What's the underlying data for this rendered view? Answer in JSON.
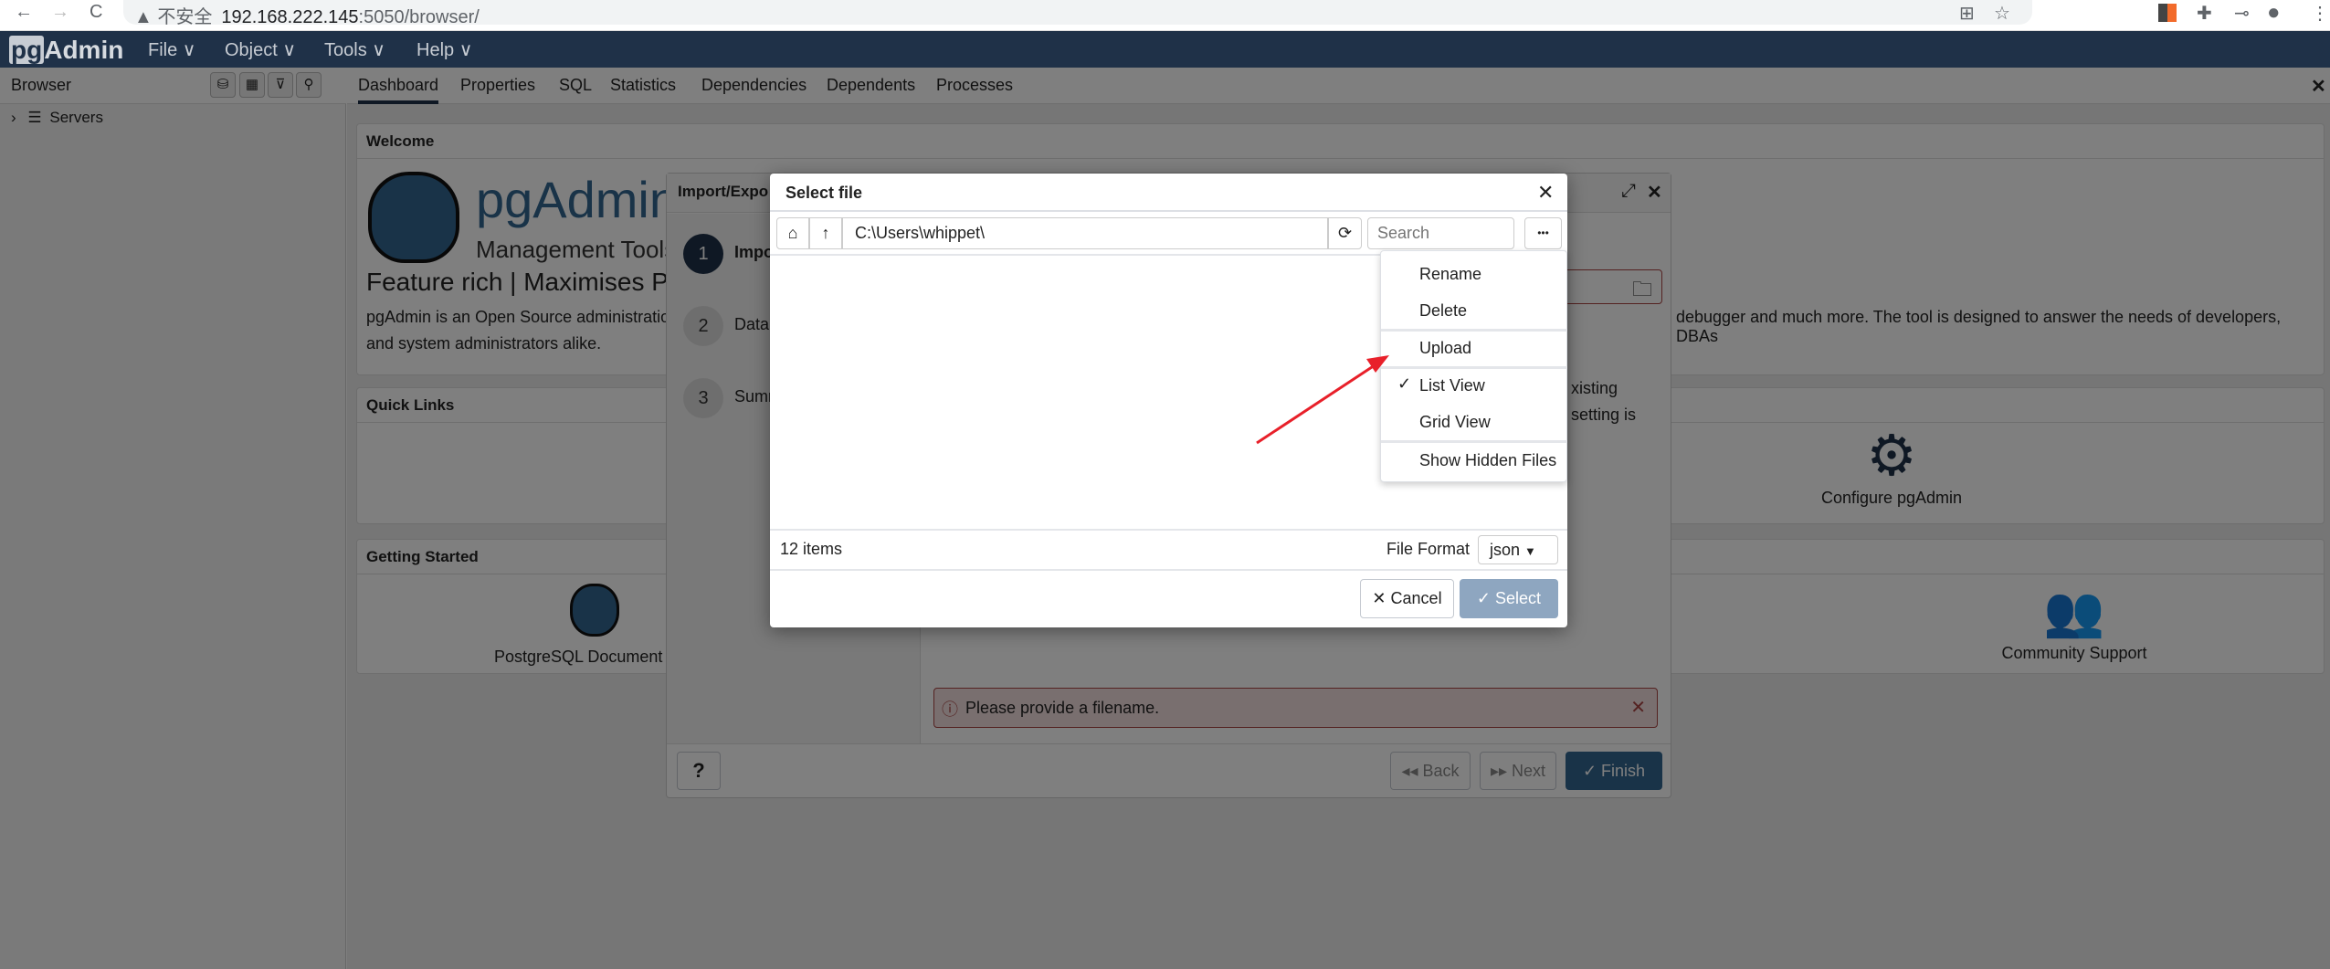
{
  "browser": {
    "back": "←",
    "forward": "→",
    "reload": "C",
    "warning": "▲ 不安全",
    "host": "192.168.222.145",
    "path": ":5050/browser/"
  },
  "app": {
    "logo_pg": "pg",
    "logo_admin": "Admin",
    "menus": [
      "File ∨",
      "Object ∨",
      "Tools ∨",
      "Help ∨"
    ]
  },
  "sidebar": {
    "title": "Browser",
    "tree": [
      {
        "label": "Servers"
      }
    ]
  },
  "tabs": [
    "Dashboard",
    "Properties",
    "SQL",
    "Statistics",
    "Dependencies",
    "Dependents",
    "Processes"
  ],
  "dashboard": {
    "welcome": {
      "title": "Welcome",
      "logo_title": "pgAdmin",
      "logo_sub": "Management Tools",
      "tagline": "Feature rich | Maximises Po",
      "desc_left_1": "pgAdmin is an Open Source administratio",
      "desc_left_2": "and system administrators alike.",
      "desc_right": "debugger and much more. The tool is designed to answer the needs of developers, DBAs"
    },
    "quick_links": {
      "title": "Quick Links",
      "configure": "Configure pgAdmin"
    },
    "getting_started": {
      "title": "Getting Started",
      "docs": "PostgreSQL Document",
      "community": "Community Support"
    }
  },
  "import_dialog": {
    "title": "Import/Expo",
    "steps": [
      {
        "n": "1",
        "label": "Impo"
      },
      {
        "n": "2",
        "label": "Datal"
      },
      {
        "n": "3",
        "label": "Sumr"
      }
    ],
    "hint_1": "xisting",
    "hint_2": "setting is",
    "error": "Please provide a filename.",
    "back": "Back",
    "next": "Next",
    "finish": "Finish",
    "help": "?"
  },
  "select_file": {
    "title": "Select file",
    "path": "C:\\Users\\whippet\\",
    "search_placeholder": "Search",
    "more": "•••",
    "menu": [
      {
        "label": "Rename",
        "checked": false
      },
      {
        "label": "Delete",
        "checked": false
      },
      {
        "label": "Upload",
        "checked": false
      },
      {
        "label": "List View",
        "checked": true
      },
      {
        "label": "Grid View",
        "checked": false
      },
      {
        "label": "Show Hidden Files",
        "checked": false
      }
    ],
    "item_count": "12 items",
    "file_format_label": "File Format",
    "file_format": "json",
    "cancel": "Cancel",
    "select": "Select"
  },
  "colors": {
    "navbar": "#1f3148",
    "primary": "#326690",
    "select_btn": "#8ea6c0",
    "error": "#a94442",
    "arrow": "#e8202a"
  }
}
